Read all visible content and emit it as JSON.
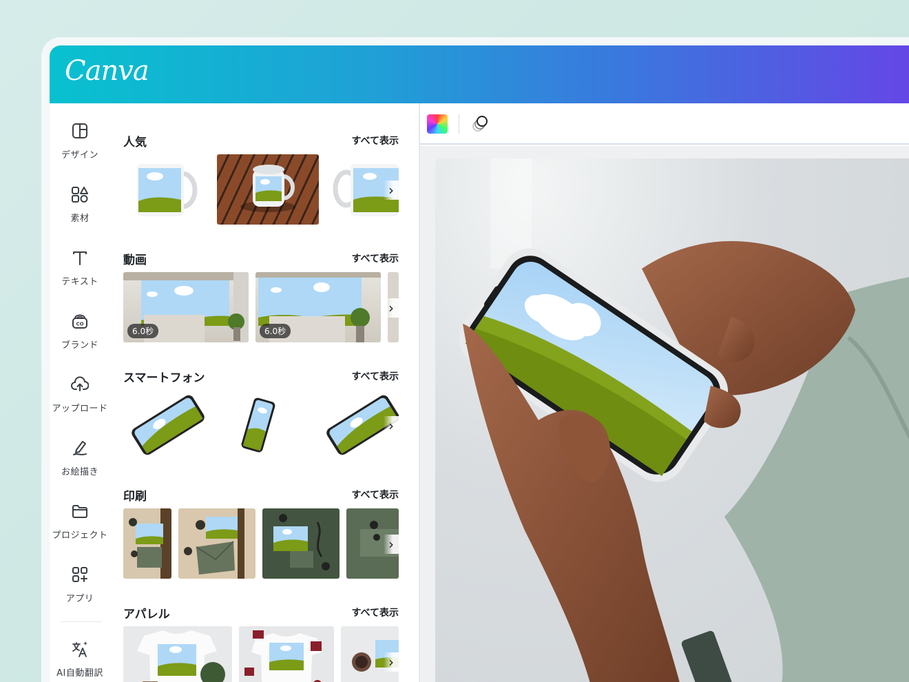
{
  "app": {
    "logo": "Canva"
  },
  "sidebar": {
    "items": [
      {
        "label": "デザイン",
        "icon": "layout-icon"
      },
      {
        "label": "素材",
        "icon": "shapes-icon"
      },
      {
        "label": "テキスト",
        "icon": "text-icon"
      },
      {
        "label": "ブランド",
        "icon": "brand-icon"
      },
      {
        "label": "アップロード",
        "icon": "upload-cloud-icon"
      },
      {
        "label": "お絵描き",
        "icon": "draw-pen-icon"
      },
      {
        "label": "プロジェクト",
        "icon": "folder-icon"
      },
      {
        "label": "アプリ",
        "icon": "apps-grid-icon"
      },
      {
        "label": "AI自動翻訳",
        "icon": "translate-icon"
      }
    ]
  },
  "panel": {
    "see_all": "すべて表示",
    "sections": [
      {
        "title": "人気"
      },
      {
        "title": "動画",
        "badges": [
          "6.0秒",
          "6.0秒"
        ]
      },
      {
        "title": "スマートフォン"
      },
      {
        "title": "印刷"
      },
      {
        "title": "アパレル"
      }
    ]
  },
  "toolbar": {
    "color_icon": "color-picker-icon",
    "layer_icon": "layers-icon"
  },
  "colors": {
    "accent_start": "#08c1cf",
    "accent_end": "#6743e6",
    "screen_sky": "#a9d4f4",
    "screen_grass": "#7a9a12"
  }
}
